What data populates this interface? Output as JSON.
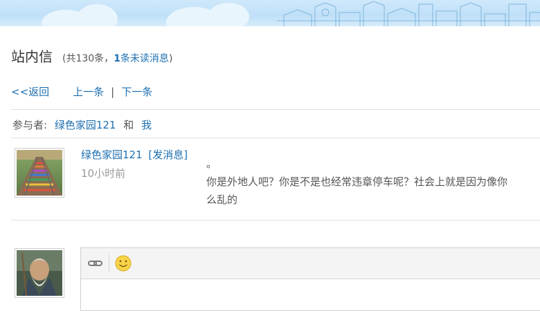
{
  "header": {
    "title": "站内信",
    "count_prefix": "(共130条，",
    "unread_count": "1",
    "unread_label": "条未读消息",
    "count_suffix": ")"
  },
  "nav": {
    "back": "<<返回",
    "prev": "上一条",
    "separator": "|",
    "next": "下一条"
  },
  "participants": {
    "label": "参与者:",
    "user": "绿色家园121",
    "conj": "和",
    "me": "我"
  },
  "message": {
    "sender": "绿色家园121",
    "send_link": "[发消息]",
    "time": "10小时前",
    "lines": [
      "。",
      "你是外地人吧？你是不是也经常违章停车呢？社会上就是因为像你",
      "么乱的"
    ]
  },
  "reply_editor": {
    "tools": [
      "link-icon",
      "emoji-icon"
    ]
  },
  "colors": {
    "link": "#1e6fb0",
    "banner": "#cfe8fb"
  }
}
